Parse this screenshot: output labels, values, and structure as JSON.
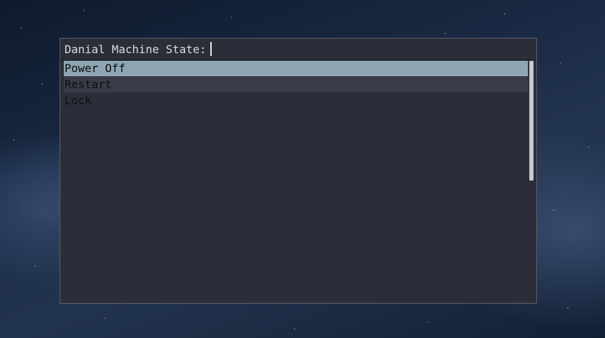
{
  "prompt": {
    "label": "Danial Machine State:",
    "input_value": ""
  },
  "menu": {
    "items": [
      {
        "label": "Power Off",
        "selected": true
      },
      {
        "label": "Restart",
        "selected": false
      },
      {
        "label": "Lock",
        "selected": false
      }
    ]
  },
  "colors": {
    "window_bg": "#2b2e38",
    "selected_bg": "#8ea6b1",
    "alt_row_bg": "#383c48",
    "text": "#d8dbe2"
  }
}
